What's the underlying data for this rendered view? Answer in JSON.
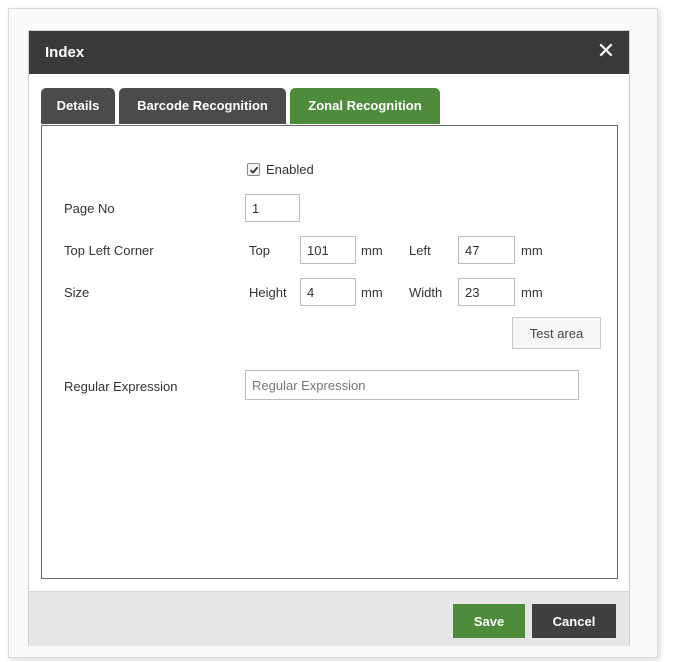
{
  "dialog": {
    "title": "Index",
    "close_glyph": "✕"
  },
  "tabs": [
    {
      "label": "Details",
      "active": false
    },
    {
      "label": "Barcode Recognition",
      "active": false
    },
    {
      "label": "Zonal Recognition",
      "active": true
    }
  ],
  "form": {
    "enabled_label": "Enabled",
    "enabled_checked": true,
    "page_no_label": "Page No",
    "page_no_value": "1",
    "top_left_label": "Top Left Corner",
    "top_label": "Top",
    "top_value": "101",
    "top_unit": "mm",
    "left_label": "Left",
    "left_value": "47",
    "left_unit": "mm",
    "size_label": "Size",
    "height_label": "Height",
    "height_value": "4",
    "height_unit": "mm",
    "width_label": "Width",
    "width_value": "23",
    "width_unit": "mm",
    "test_area_label": "Test area",
    "regex_label": "Regular Expression",
    "regex_placeholder": "Regular Expression",
    "regex_value": ""
  },
  "footer": {
    "save_label": "Save",
    "cancel_label": "Cancel"
  },
  "colors": {
    "accent_green": "#4e8b3a",
    "titlebar": "#3a3a3a",
    "tab_inactive": "#4b4b4b"
  },
  "icons": {
    "close": "close-icon",
    "checkbox": "checkmark-icon"
  }
}
